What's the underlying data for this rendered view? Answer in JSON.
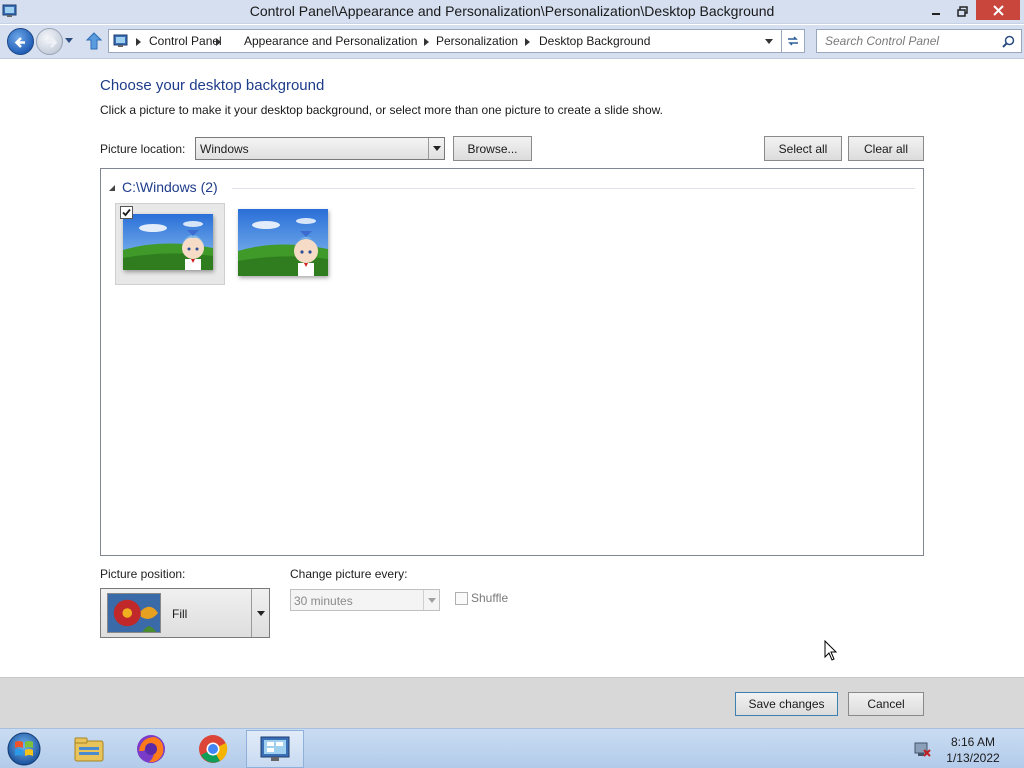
{
  "window": {
    "title": "Control Panel\\Appearance and Personalization\\Personalization\\Desktop Background"
  },
  "breadcrumb": [
    "Control Panel",
    "Appearance and Personalization",
    "Personalization",
    "Desktop Background"
  ],
  "search": {
    "placeholder": "Search Control Panel"
  },
  "content": {
    "heading": "Choose your desktop background",
    "subtext": "Click a picture to make it your desktop background, or select more than one picture to create a slide show.",
    "picture_location_label": "Picture location:",
    "picture_location_value": "Windows",
    "browse_label": "Browse...",
    "select_all_label": "Select all",
    "clear_all_label": "Clear all"
  },
  "gallery": {
    "group_title": "C:\\Windows (2)",
    "pictures": [
      {
        "selected": true
      },
      {
        "selected": false
      }
    ]
  },
  "options": {
    "position_label": "Picture position:",
    "position_value": "Fill",
    "change_label": "Change picture every:",
    "change_value": "30 minutes",
    "shuffle_label": "Shuffle"
  },
  "commands": {
    "save_label": "Save changes",
    "cancel_label": "Cancel"
  },
  "taskbar": {
    "time": "8:16 AM",
    "date": "1/13/2022",
    "items": [
      "file-explorer-icon",
      "firefox-icon",
      "chrome-icon",
      "control-panel-icon"
    ]
  },
  "colors": {
    "heading": "#1e3c8a",
    "titlebar": "#d5dff0",
    "close_button": "#c9463d"
  }
}
